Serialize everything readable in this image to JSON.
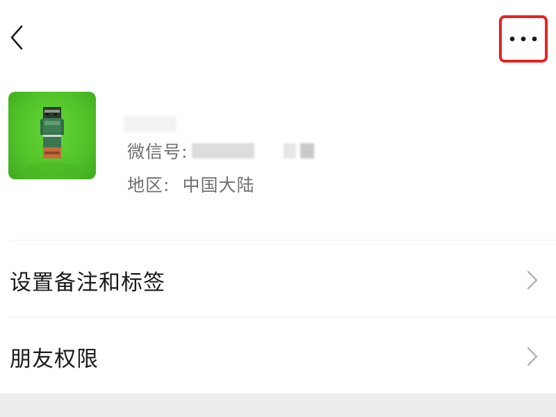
{
  "topbar": {
    "back_icon": "chevron-left-icon",
    "more_icon": "more-horizontal-icon",
    "highlight_color": "#e8211f"
  },
  "profile": {
    "wechat_id_label": "微信号:",
    "region_label": "地区:",
    "region_value": "中国大陆"
  },
  "menu": {
    "items": [
      {
        "label": "设置备注和标签",
        "icon": "chevron-right-icon"
      },
      {
        "label": "朋友权限",
        "icon": "chevron-right-icon"
      }
    ]
  }
}
